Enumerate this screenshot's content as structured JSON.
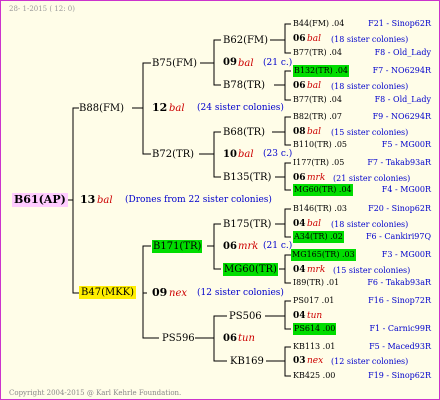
{
  "header": "28-  1-2015 ( 12:  0)",
  "footer": "Copyright 2004-2015 @ Karl Kehrle Foundation.",
  "root": {
    "name": "B61(AP)",
    "gen": "13",
    "sire": "bal",
    "note": "(Drones from 22 sister colonies)"
  },
  "g1_top": {
    "name": "B88(FM)",
    "gen": "12",
    "sire": "bal",
    "note": "(24 sister colonies)"
  },
  "g1_bot": {
    "name": "B47(MKK)",
    "gen": "09",
    "sire": "nex",
    "note": "(12 sister colonies)"
  },
  "g2_a": {
    "name": "B75(FM)",
    "gen": "09",
    "sire": "bal",
    "note": "(21 c.)"
  },
  "g2_b": {
    "name": "B72(TR)",
    "gen": "10",
    "sire": "bal",
    "note": "(23 c.)"
  },
  "g2_c": {
    "name": "B171(TR)",
    "gen": "06",
    "sire": "mrk",
    "note": "(21 c.)"
  },
  "g2_d": {
    "name": "PS596",
    "gen": "06",
    "sire": "tun",
    "note": ""
  },
  "g3": [
    {
      "name": "B62(FM)",
      "gen": "06",
      "sire": "bal",
      "note": "(18 sister colonies)"
    },
    {
      "name": "B78(TR)",
      "gen": "06",
      "sire": "bal",
      "note": "(18 sister colonies)"
    },
    {
      "name": "B68(TR)",
      "gen": "08",
      "sire": "bal",
      "note": "(15 sister colonies)"
    },
    {
      "name": "B135(TR)",
      "gen": "06",
      "sire": "mrk",
      "note": "(21 sister colonies)"
    },
    {
      "name": "B175(TR)",
      "gen": "04",
      "sire": "bal",
      "note": "(18 sister colonies)"
    },
    {
      "name": "MG60(TR)",
      "gen": "04",
      "sire": "mrk",
      "note": "(15 sister colonies)"
    },
    {
      "name": "PS506",
      "gen": "04",
      "sire": "tun",
      "note": ""
    },
    {
      "name": "KB169",
      "gen": "03",
      "sire": "nex",
      "note": "(12 sister colonies)"
    }
  ],
  "g4": [
    {
      "name": "B44(FM) .04",
      "loc": "F21 - Sinop62R"
    },
    {
      "name": "B77(TR) .04",
      "loc": "F8 - Old_Lady"
    },
    {
      "name": "B132(TR) .04",
      "loc": "F7 - NO6294R"
    },
    {
      "name": "B77(TR) .04",
      "loc": "F8 - Old_Lady"
    },
    {
      "name": "B82(TR) .07",
      "loc": "F9 - NO6294R"
    },
    {
      "name": "B110(TR) .05",
      "loc": "F5 - MG00R"
    },
    {
      "name": "I177(TR) .05",
      "loc": "F7 - Takab93aR"
    },
    {
      "name": "MG60(TR) .04",
      "loc": "F4 - MG00R"
    },
    {
      "name": "B146(TR) .03",
      "loc": "F20 - Sinop62R"
    },
    {
      "name": "A34(TR) .02",
      "loc": "F6 - Cankiri97Q"
    },
    {
      "name": "MG165(TR) .03",
      "loc": "F3 - MG00R"
    },
    {
      "name": "I89(TR) .01",
      "loc": "F6 - Takab93aR"
    },
    {
      "name": "PS017 .01",
      "loc": "F16 - Sinop72R"
    },
    {
      "name": "PS614 .00",
      "loc": "F1 - Carnic99R"
    },
    {
      "name": "KB113 .01",
      "loc": "F5 - Maced93R"
    },
    {
      "name": "KB425 .00",
      "loc": "F19 - Sinop62R"
    }
  ]
}
